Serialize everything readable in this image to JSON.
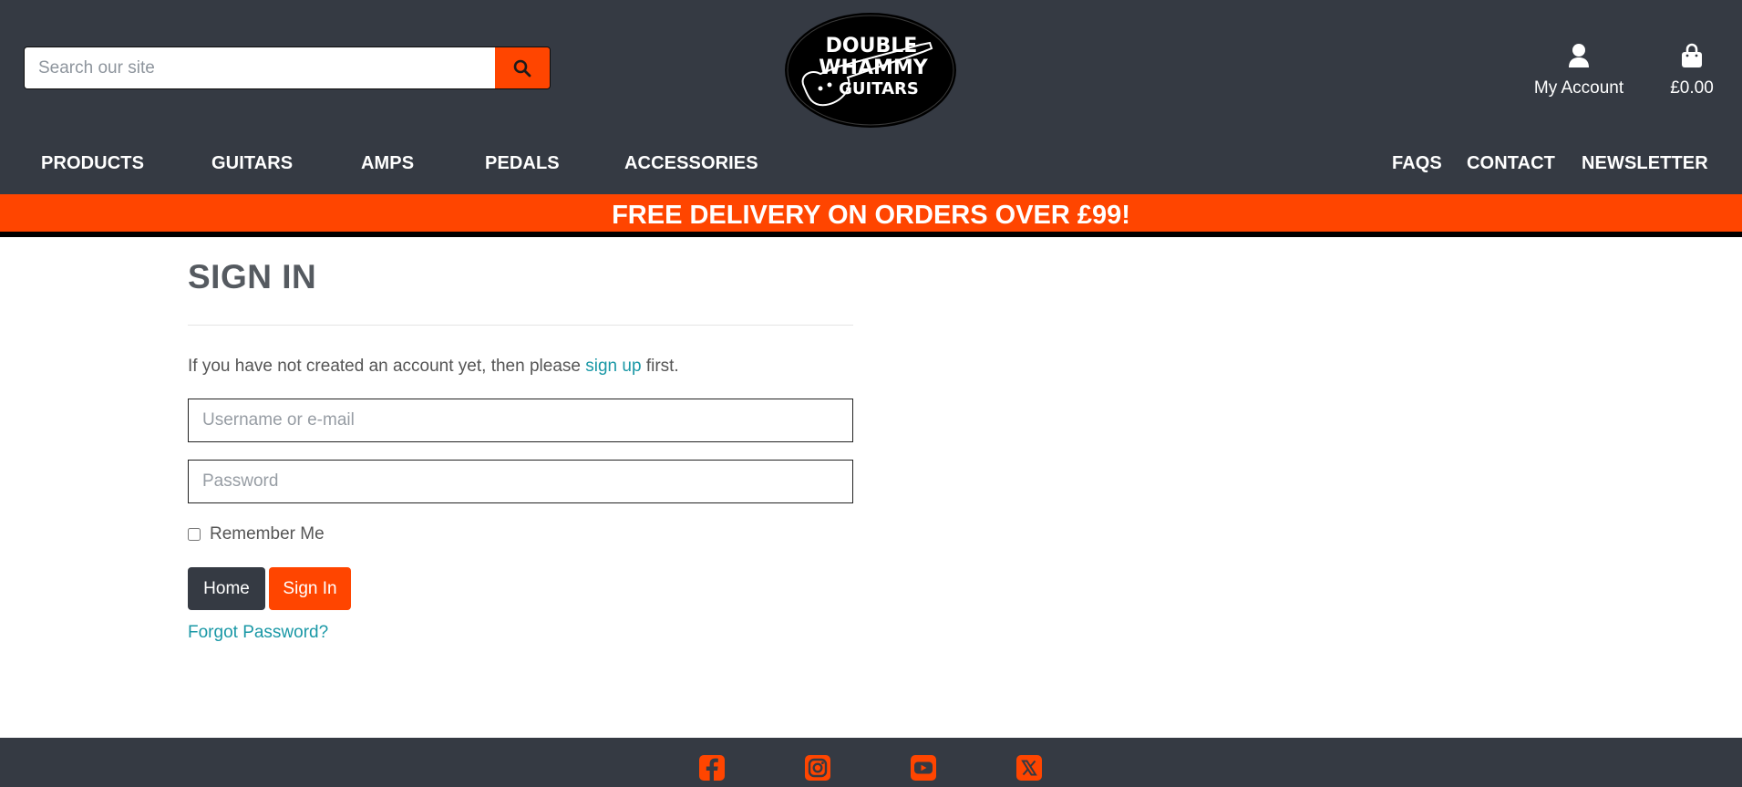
{
  "header": {
    "search": {
      "placeholder": "Search our site",
      "value": "",
      "icon": "search-icon"
    },
    "logo": {
      "line1": "DOUBLE",
      "line2": "WHAMMY",
      "line3": "GUITARS"
    },
    "account": {
      "label": "My Account",
      "icon": "user-icon"
    },
    "cart": {
      "total": "£0.00",
      "icon": "shopping-bag-icon"
    }
  },
  "nav": {
    "main": [
      "PRODUCTS",
      "GUITARS",
      "AMPS",
      "PEDALS",
      "ACCESSORIES"
    ],
    "secondary": [
      "FAQS",
      "CONTACT",
      "NEWSLETTER"
    ]
  },
  "banner": {
    "text": "FREE DELIVERY ON ORDERS OVER £99!"
  },
  "signin": {
    "title": "SIGN IN",
    "intro_before": "If you have not created an account yet, then please",
    "intro_link": "sign up",
    "intro_after": "first.",
    "username_placeholder": "Username or e-mail",
    "password_placeholder": "Password",
    "remember_label": "Remember Me",
    "home_button": "Home",
    "signin_button": "Sign In",
    "forgot_link": "Forgot Password?"
  },
  "footer": {
    "social": [
      "facebook-icon",
      "instagram-icon",
      "youtube-icon",
      "x-icon"
    ]
  },
  "colors": {
    "header_bg": "#353a43",
    "accent": "#ff4500",
    "link": "#1a98a6",
    "text": "#555555"
  }
}
